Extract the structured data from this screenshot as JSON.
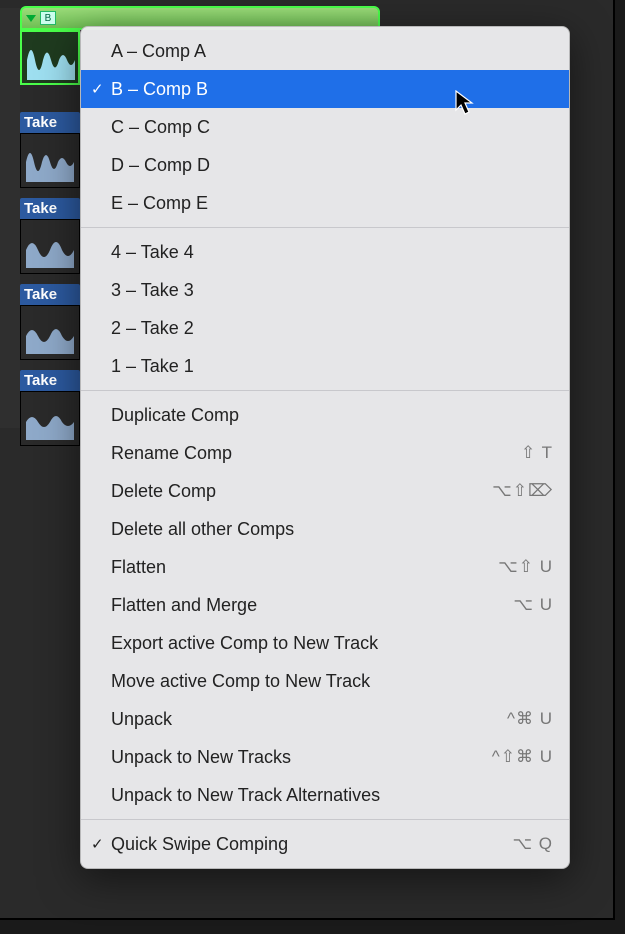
{
  "tracks": {
    "header_letter": "B",
    "takes": [
      {
        "label": ""
      },
      {
        "label": "Take"
      },
      {
        "label": "Take"
      },
      {
        "label": "Take"
      },
      {
        "label": "Take"
      }
    ]
  },
  "menu": {
    "group_comps": [
      {
        "label": "A – Comp A",
        "checked": false,
        "selected": false
      },
      {
        "label": "B – Comp B",
        "checked": true,
        "selected": true
      },
      {
        "label": "C – Comp C",
        "checked": false,
        "selected": false
      },
      {
        "label": "D – Comp D",
        "checked": false,
        "selected": false
      },
      {
        "label": "E – Comp E",
        "checked": false,
        "selected": false
      }
    ],
    "group_takes": [
      {
        "label": "4 – Take 4"
      },
      {
        "label": "3 – Take 3"
      },
      {
        "label": "2 – Take 2"
      },
      {
        "label": "1 – Take 1"
      }
    ],
    "group_cmds": [
      {
        "label": "Duplicate Comp",
        "shortcut": ""
      },
      {
        "label": "Rename Comp",
        "shortcut": "⇧ T"
      },
      {
        "label": "Delete Comp",
        "shortcut": "⌥⇧⌦"
      },
      {
        "label": "Delete all other Comps",
        "shortcut": ""
      },
      {
        "label": "Flatten",
        "shortcut": "⌥⇧ U"
      },
      {
        "label": "Flatten and Merge",
        "shortcut": "⌥ U"
      },
      {
        "label": "Export active Comp to New Track",
        "shortcut": ""
      },
      {
        "label": "Move active Comp to New Track",
        "shortcut": ""
      },
      {
        "label": "Unpack",
        "shortcut": "^⌘ U"
      },
      {
        "label": "Unpack to New Tracks",
        "shortcut": "^⇧⌘ U"
      },
      {
        "label": "Unpack to New Track Alternatives",
        "shortcut": ""
      }
    ],
    "group_toggle": [
      {
        "label": "Quick Swipe Comping",
        "checked": true,
        "shortcut": "⌥ Q"
      }
    ]
  }
}
